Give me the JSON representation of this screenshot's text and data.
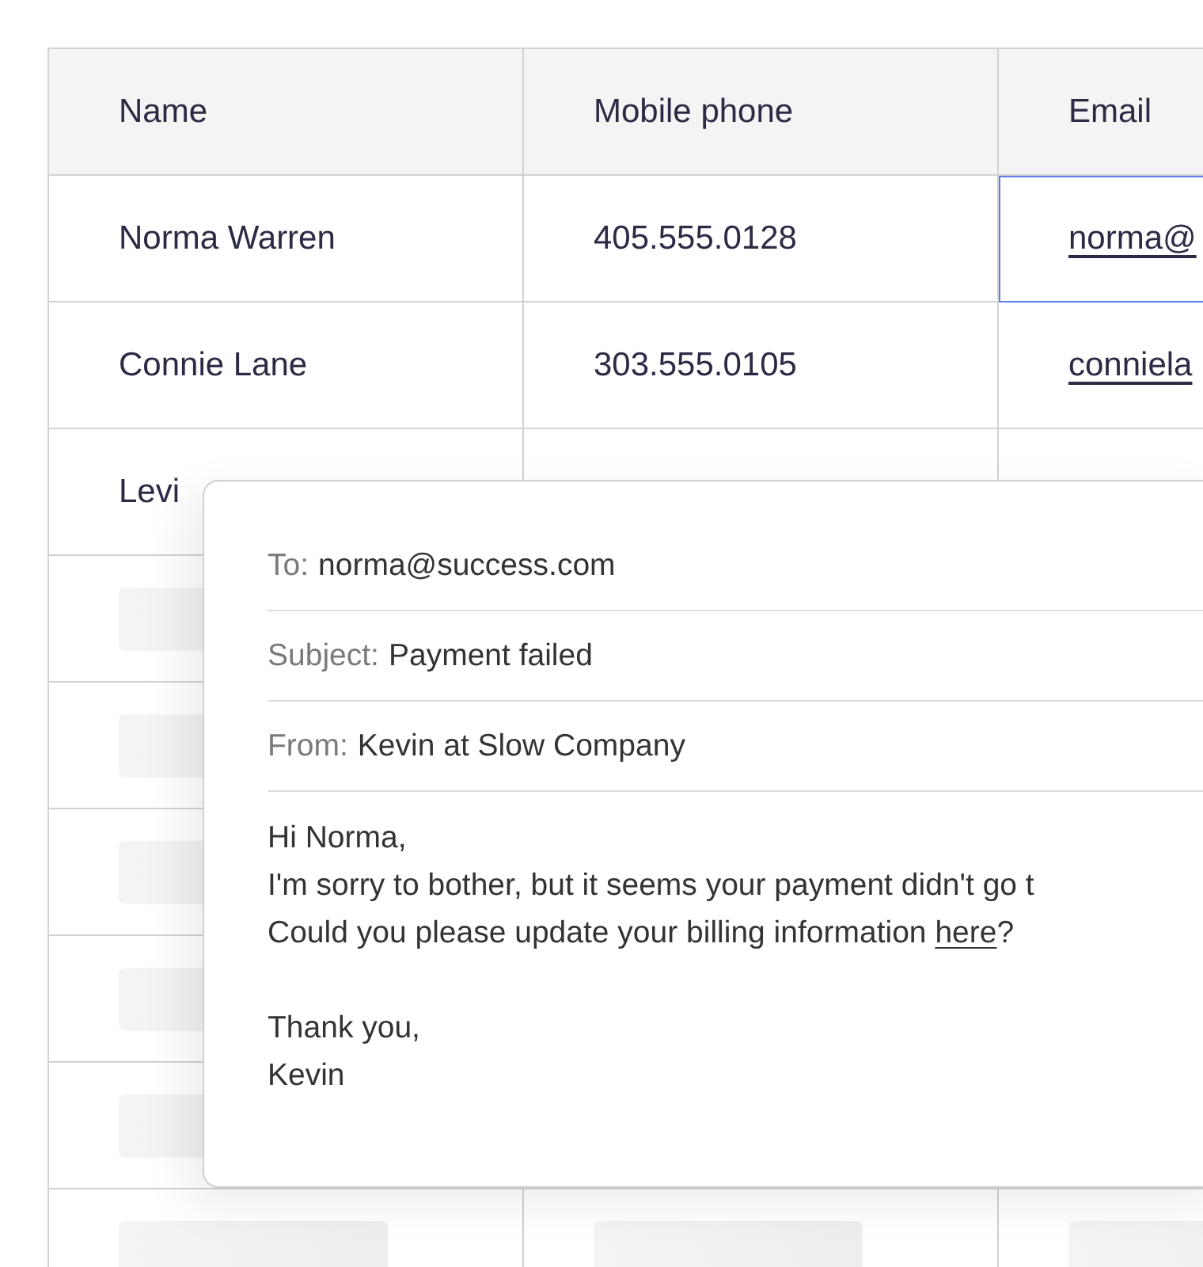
{
  "table": {
    "columns": [
      {
        "label": "Name"
      },
      {
        "label": "Mobile phone"
      },
      {
        "label": "Email"
      }
    ],
    "rows": [
      {
        "kind": "data",
        "cells": [
          {
            "kind": "text",
            "text": "Norma Warren",
            "selected": false
          },
          {
            "kind": "text",
            "text": "405.555.0128",
            "selected": false
          },
          {
            "kind": "link",
            "text": "norma@",
            "selected": true
          }
        ]
      },
      {
        "kind": "data",
        "cells": [
          {
            "kind": "text",
            "text": "Connie Lane",
            "selected": false
          },
          {
            "kind": "text",
            "text": "303.555.0105",
            "selected": false
          },
          {
            "kind": "link",
            "text": "conniela",
            "selected": false
          }
        ]
      },
      {
        "kind": "data",
        "cells": [
          {
            "kind": "text",
            "text": "Levi",
            "selected": false
          }
        ]
      },
      {
        "kind": "placeholder"
      },
      {
        "kind": "placeholder"
      },
      {
        "kind": "placeholder"
      },
      {
        "kind": "placeholder"
      },
      {
        "kind": "placeholder"
      },
      {
        "kind": "placeholder"
      }
    ]
  },
  "email_popup": {
    "fields": [
      {
        "label": "To:",
        "value": "norma@success.com"
      },
      {
        "label": "Subject:",
        "value": "Payment failed"
      },
      {
        "label": "From:",
        "value": "Kevin at Slow Company"
      }
    ],
    "paragraphs": [
      {
        "lines": [
          {
            "text": "Hi Norma,"
          },
          {
            "text": "I'm sorry to bother, but it seems your payment didn't go t"
          },
          {
            "text": "Could you please update your billing information ",
            "link": "here",
            "after": "?"
          }
        ]
      },
      {
        "lines": [
          {
            "text": "Thank you,"
          },
          {
            "text": "Kevin"
          }
        ]
      }
    ]
  }
}
